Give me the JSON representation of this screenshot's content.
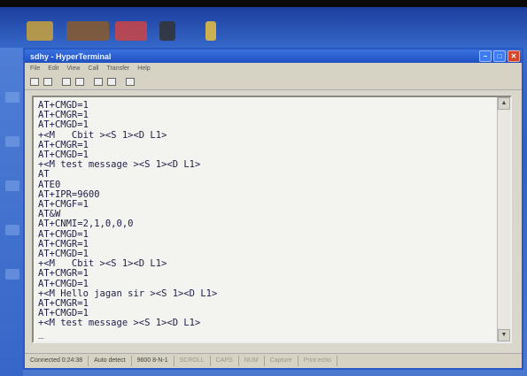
{
  "window": {
    "title": "sdhy - HyperTerminal"
  },
  "menu": [
    "File",
    "Edit",
    "View",
    "Call",
    "Transfer",
    "Help"
  ],
  "terminal": {
    "lines": [
      "AT+CMGD=1",
      "AT+CMGR=1",
      "AT+CMGD=1",
      "+<M   Cbit ><S 1><D L1>",
      "AT+CMGR=1",
      "AT+CMGD=1",
      "+<M test message ><S 1><D L1>",
      "AT",
      "ATE0",
      "AT+IPR=9600",
      "AT+CMGF=1",
      "AT&W",
      "AT+CNMI=2,1,0,0,0",
      "AT+CMGD=1",
      "AT+CMGR=1",
      "AT+CMGD=1",
      "+<M   Cbit ><S 1><D L1>",
      "AT+CMGR=1",
      "AT+CMGD=1",
      "+<M Hello jagan sir ><S 1><D L1>",
      "AT+CMGR=1",
      "AT+CMGD=1",
      "+<M test message ><S 1><D L1>",
      "_"
    ]
  },
  "status": {
    "connected": "Connected 0:24:38",
    "detect": "Auto detect",
    "port": "9600 8-N-1",
    "scroll": "SCROLL",
    "caps": "CAPS",
    "num": "NUM",
    "capture": "Capture",
    "print_echo": "Print echo"
  }
}
